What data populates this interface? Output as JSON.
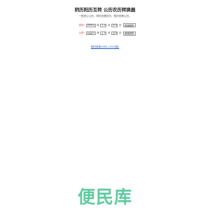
{
  "header": {
    "title": "阴历阳历互转 公历农历转换器"
  },
  "instruction": "一般查公公历，阴历查看农历，阳历查看公历。",
  "lunar_row": {
    "label": "农历:",
    "year": "1990",
    "year_unit": "年",
    "month": "1",
    "month_unit": "月",
    "day": "27",
    "day_unit": "日",
    "button": "查询阳历"
  },
  "solar_row": {
    "label": "公历:",
    "year": "1990",
    "year_unit": "年",
    "month": "1",
    "month_unit": "月",
    "day": "27",
    "day_unit": "日",
    "button": "查询农历"
  },
  "footer": {
    "link": "阴历转换1900-2100(暂)"
  },
  "watermark": {
    "text": "便民库"
  },
  "colors": {
    "label": "#e0322d",
    "link": "#2a55c8",
    "watermark": "#5fcaa1"
  }
}
